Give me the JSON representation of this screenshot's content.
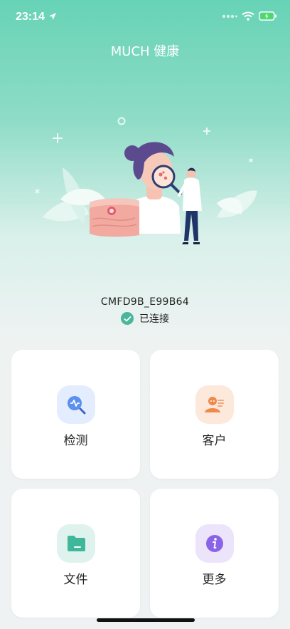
{
  "status_bar": {
    "time": "23:14"
  },
  "header": {
    "title": "MUCH 健康"
  },
  "device": {
    "name": "CMFD9B_E99B64",
    "status": "已连接"
  },
  "menu": [
    {
      "label": "检测",
      "icon": "detect-search-icon",
      "color": "#5b8ff0"
    },
    {
      "label": "客户",
      "icon": "customer-icon",
      "color": "#f08a4b"
    },
    {
      "label": "文件",
      "icon": "folder-icon",
      "color": "#3fb79a"
    },
    {
      "label": "更多",
      "icon": "more-info-icon",
      "color": "#8b63e6"
    }
  ],
  "colors": {
    "accent": "#67d3b6",
    "connected": "#49b89a"
  }
}
